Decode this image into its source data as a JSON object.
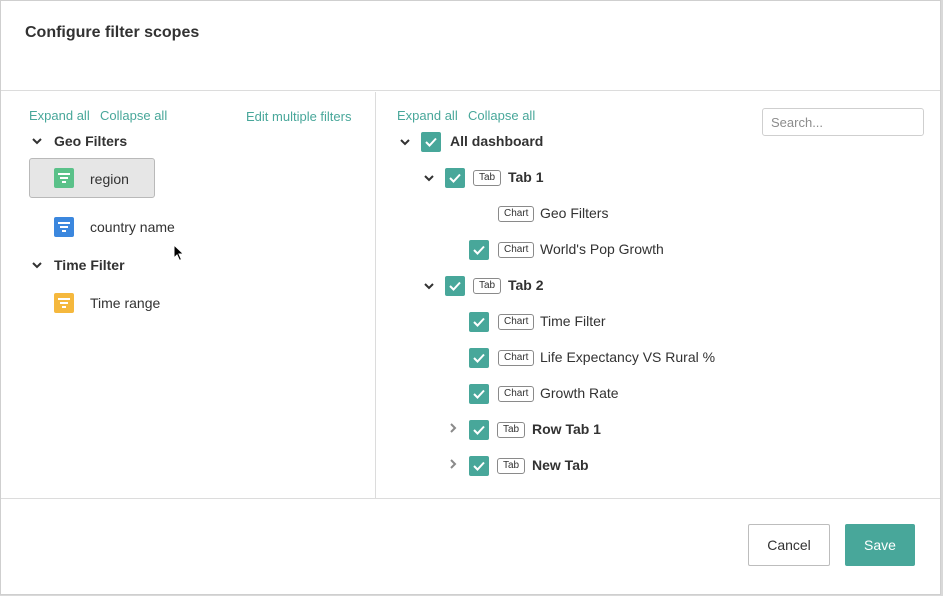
{
  "modal": {
    "title": "Configure filter scopes"
  },
  "left": {
    "expand_all": "Expand all",
    "collapse_all": "Collapse all",
    "edit_multiple": "Edit multiple filters",
    "groups": [
      {
        "label": "Geo Filters",
        "items": [
          {
            "label": "region",
            "icon": "filter-icon-green",
            "color": "#5ac189",
            "selected": true
          },
          {
            "label": "country name",
            "icon": "filter-icon-blue",
            "color": "#3b87de",
            "selected": false
          }
        ]
      },
      {
        "label": "Time Filter",
        "items": [
          {
            "label": "Time range",
            "icon": "filter-icon-yellow",
            "color": "#f5b83d",
            "selected": false
          }
        ]
      }
    ]
  },
  "right": {
    "expand_all": "Expand all",
    "collapse_all": "Collapse all",
    "search_placeholder": "Search...",
    "tree": {
      "root": "All dashboard",
      "tab_badge": "Tab",
      "chart_badge": "Chart",
      "tab1": {
        "label": "Tab 1",
        "charts": [
          {
            "label": "Geo Filters",
            "checked": false
          },
          {
            "label": "World's Pop Growth",
            "checked": true
          }
        ]
      },
      "tab2": {
        "label": "Tab 2",
        "charts": [
          {
            "label": "Time Filter",
            "checked": true
          },
          {
            "label": "Life Expectancy VS Rural %",
            "checked": true
          },
          {
            "label": "Growth Rate",
            "checked": true
          }
        ],
        "subtabs": [
          {
            "label": "Row Tab 1",
            "checked": true
          },
          {
            "label": "New Tab",
            "checked": true
          }
        ]
      }
    }
  },
  "footer": {
    "cancel": "Cancel",
    "save": "Save"
  },
  "colors": {
    "accent": "#48a79a"
  }
}
